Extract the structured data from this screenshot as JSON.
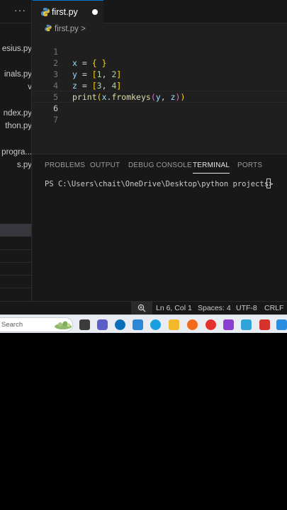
{
  "sidebar": {
    "files": [
      "esius.py",
      "inals.py",
      "v",
      "",
      "ndex.py",
      "thon.py",
      "progra...",
      "s.py"
    ]
  },
  "tab": {
    "filename": "first.py"
  },
  "breadcrumb": {
    "file": "first.py",
    "separator": ">"
  },
  "editor": {
    "line_numbers": [
      "1",
      "2",
      "3",
      "4",
      "5",
      "6",
      "7"
    ],
    "code": {
      "line1": {
        "name": "x",
        "eq": " = ",
        "open": "{",
        "space": " ",
        "close": "}"
      },
      "line2": {
        "name": "y",
        "eq": " = ",
        "open": "[",
        "a": "1",
        "comma": ", ",
        "b": "2",
        "close": "]"
      },
      "line3": {
        "name": "z",
        "eq": " = ",
        "open": "[",
        "a": "3",
        "comma": ", ",
        "b": "4",
        "close": "]"
      },
      "line4": {
        "fn": "print",
        "open1": "(",
        "obj": "x",
        "dot": ".",
        "method": "fromkeys",
        "open2": "(",
        "a": "y",
        "comma": ", ",
        "b": "z",
        "close2": ")",
        "close1": ")"
      }
    }
  },
  "panel": {
    "tabs": [
      "PROBLEMS",
      "OUTPUT",
      "DEBUG CONSOLE",
      "TERMINAL",
      "PORTS"
    ],
    "active_tab": "TERMINAL",
    "prompt": "PS C:\\Users\\chait\\OneDrive\\Desktop\\python projects>"
  },
  "status_bar": {
    "position": "Ln 6, Col 1",
    "indent": "Spaces: 4",
    "encoding": "UTF-8",
    "eol": "CRLF"
  },
  "taskbar": {
    "search_text": "Search",
    "icons": [
      "task-view-icon",
      "teams-icon",
      "dell-icon",
      "store-icon",
      "edge-icon",
      "file-explorer-icon",
      "firefox-icon",
      "chrome-icon",
      "clipchamp-icon",
      "notepad-icon",
      "wps-icon",
      "vscode-icon"
    ]
  },
  "colors": {
    "accent": "#0078d4",
    "editor_bg": "#1f1f1f",
    "panel_bg": "#181818",
    "bracket_1": "#ffd700",
    "bracket_2": "#da70d6",
    "bracket_3": "#179fff"
  }
}
